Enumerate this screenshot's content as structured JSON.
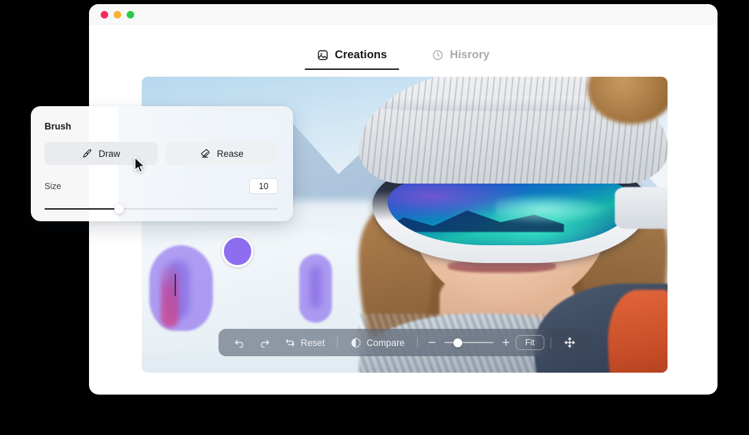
{
  "window": {
    "traffic_lights": [
      {
        "name": "close",
        "color": "#f72a5c"
      },
      {
        "name": "minimize",
        "color": "#fbb22c"
      },
      {
        "name": "maximize",
        "color": "#2bcc4a"
      }
    ]
  },
  "tabs": [
    {
      "label": "Creations",
      "icon": "image-icon",
      "active": true
    },
    {
      "label": "Hisrory",
      "icon": "clock-icon",
      "active": false
    }
  ],
  "brush_panel": {
    "title": "Brush",
    "modes": [
      {
        "label": "Draw",
        "icon": "paintbrush-icon",
        "selected": true
      },
      {
        "label": "Rease",
        "icon": "eraser-icon",
        "selected": false
      }
    ],
    "size_label": "Size",
    "size_value": "10",
    "size_percent": 32
  },
  "toolbar": {
    "undo_label": "Undo",
    "redo_label": "Redo",
    "reset_label": "Reset",
    "compare_label": "Compare",
    "zoom_out_label": "−",
    "zoom_in_label": "+",
    "fit_label": "Fit",
    "pan_label": "Pan",
    "zoom_percent": 18
  },
  "canvas": {
    "image_description": "Smiling woman wearing a grey knit beanie and blue-teal mirrored ski goggles in snowy mountains",
    "brush_color": "#8d6ef0"
  }
}
